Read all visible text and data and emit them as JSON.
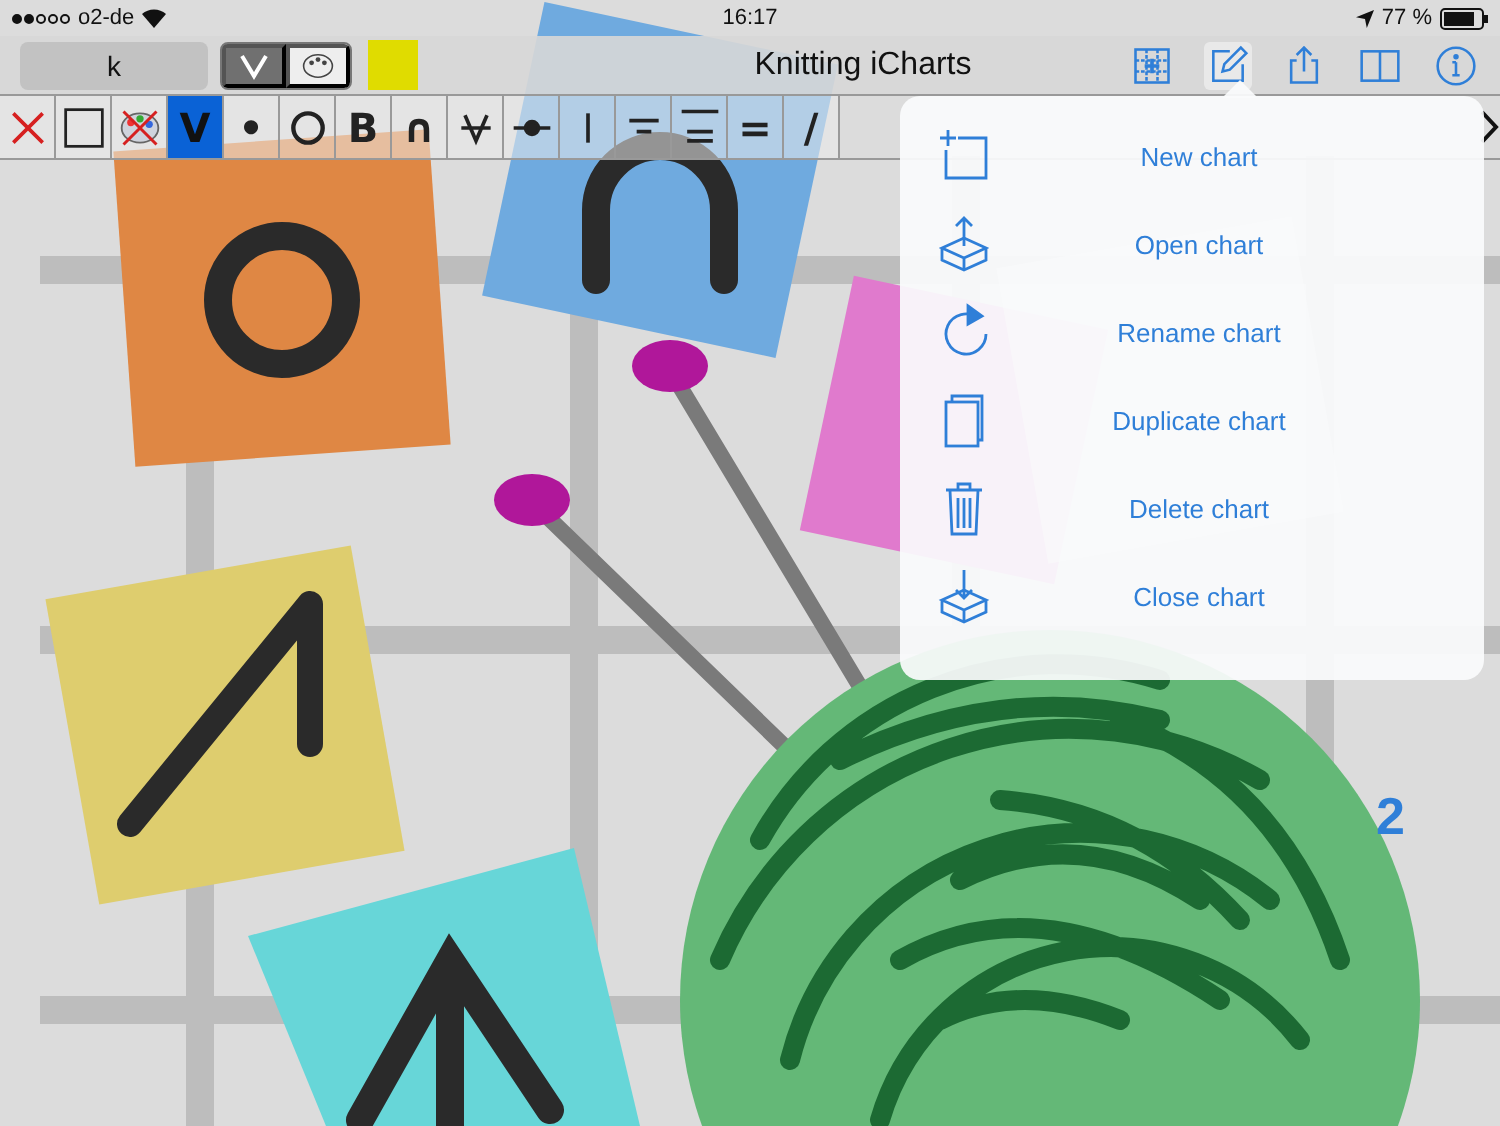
{
  "status_bar": {
    "carrier": "o2-de",
    "time": "16:17",
    "battery": "77 %"
  },
  "toolbar": {
    "stitch_field": {
      "value": "k"
    },
    "mode_segments": [
      {
        "kind": "symbol",
        "selected": true
      },
      {
        "kind": "color",
        "selected": false
      }
    ],
    "title": "Knitting iCharts",
    "actions": [
      {
        "kind": "grid",
        "selected": false
      },
      {
        "kind": "edit",
        "selected": true
      },
      {
        "kind": "share",
        "selected": false
      },
      {
        "kind": "book",
        "selected": false
      },
      {
        "kind": "info",
        "selected": false
      }
    ]
  },
  "symbol_palette": [
    {
      "kind": "clear",
      "selected": false
    },
    {
      "kind": "empty",
      "selected": false
    },
    {
      "kind": "no-color",
      "selected": false
    },
    {
      "kind": "text",
      "text": "V",
      "selected": true
    },
    {
      "kind": "text",
      "text": "•",
      "selected": false
    },
    {
      "kind": "ring",
      "selected": false
    },
    {
      "kind": "text",
      "text": "B",
      "selected": false
    },
    {
      "kind": "text",
      "text": "∩",
      "selected": false
    },
    {
      "kind": "crossed-v",
      "selected": false
    },
    {
      "kind": "bar-dot",
      "selected": false
    },
    {
      "kind": "vertical",
      "selected": false
    },
    {
      "kind": "overline",
      "selected": false
    },
    {
      "kind": "double-top",
      "selected": false
    },
    {
      "kind": "text",
      "text": "=",
      "selected": false
    },
    {
      "kind": "text",
      "text": "/",
      "selected": false
    }
  ],
  "artwork": {
    "label": "2"
  },
  "chart_menu": [
    {
      "kind": "new",
      "label": "New chart"
    },
    {
      "kind": "open",
      "label": "Open chart"
    },
    {
      "kind": "rename",
      "label": "Rename chart"
    },
    {
      "kind": "duplicate",
      "label": "Duplicate chart"
    },
    {
      "kind": "delete",
      "label": "Delete chart"
    },
    {
      "kind": "close",
      "label": "Close chart"
    }
  ]
}
